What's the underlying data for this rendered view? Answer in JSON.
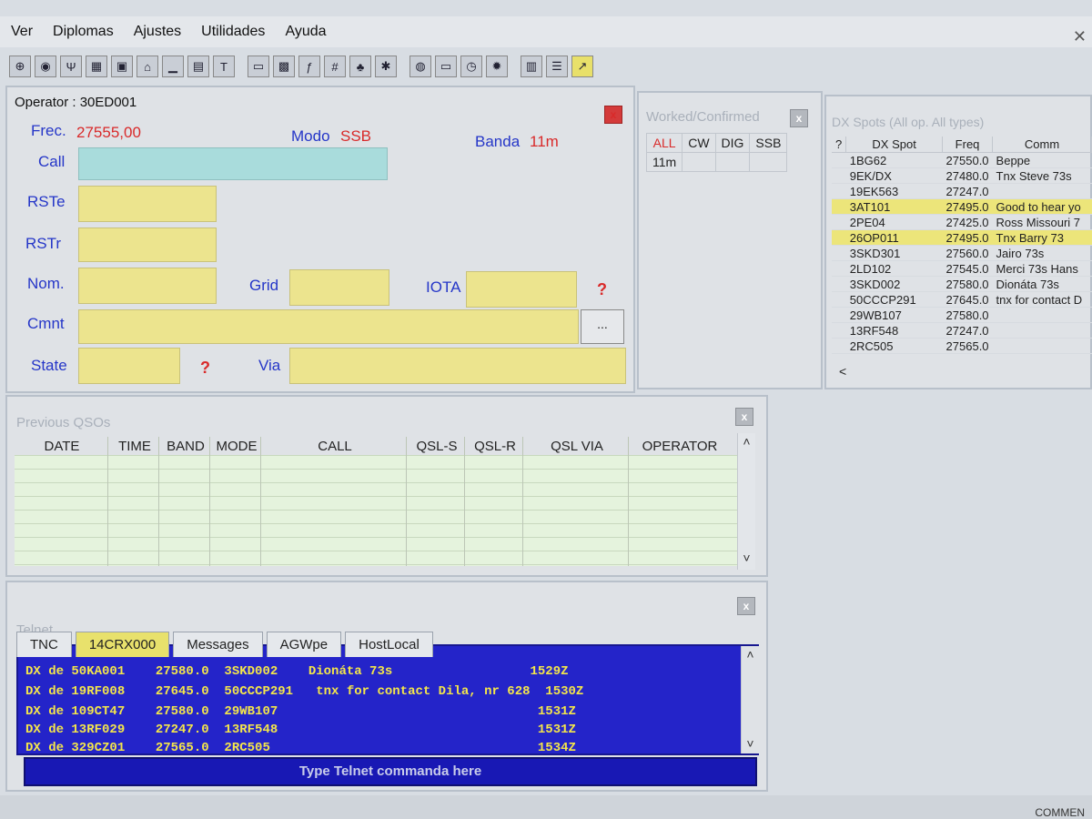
{
  "menu": [
    "Ver",
    "Diplomas",
    "Ajustes",
    "Utilidades",
    "Ayuda"
  ],
  "toolbar_icons": [
    "globe-icon",
    "radio-icon",
    "antenna-icon",
    "table-icon",
    "image-icon",
    "house-icon",
    "chart-icon",
    "notebook-icon",
    "text-icon",
    "window-icon",
    "map-icon",
    "fn-icon",
    "calculator-icon",
    "tree-icon",
    "bug-icon",
    "earth-icon",
    "monitor-icon",
    "clock-icon",
    "gear-icon",
    "calendar-icon",
    "align-icon",
    "arrow-icon"
  ],
  "qso": {
    "operator_label": "Operator : 30ED001",
    "close": "x",
    "frec_label": "Frec.",
    "frec_value": "27555,00",
    "modo_label": "Modo",
    "modo_value": "SSB",
    "banda_label": "Banda",
    "banda_value": "11m",
    "call_label": "Call",
    "rste_label": "RSTe",
    "rstr_label": "RSTr",
    "nom_label": "Nom.",
    "grid_label": "Grid",
    "iota_label": "IOTA",
    "cmnt_label": "Cmnt",
    "state_label": "State",
    "via_label": "Via",
    "help_mark": "?",
    "more_button": "..."
  },
  "worked": {
    "title": "Worked/Confirmed",
    "columns": [
      "ALL",
      "CW",
      "DIG",
      "SSB"
    ],
    "row_band": "11m"
  },
  "spots": {
    "title": "DX Spots (All op. All types)",
    "columns": [
      "?",
      "DX Spot",
      "Freq",
      "Comm"
    ],
    "rows": [
      {
        "call": "1BG62",
        "freq": "27550.0",
        "comment": "Beppe",
        "hl": false
      },
      {
        "call": "9EK/DX",
        "freq": "27480.0",
        "comment": "Tnx  Steve 73s",
        "hl": false
      },
      {
        "call": "19EK563",
        "freq": "27247.0",
        "comment": "",
        "hl": false
      },
      {
        "call": "3AT101",
        "freq": "27495.0",
        "comment": "Good to hear yo",
        "hl": true
      },
      {
        "call": "2PE04",
        "freq": "27425.0",
        "comment": "Ross Missouri 7",
        "hl": false
      },
      {
        "call": "26OP011",
        "freq": "27495.0",
        "comment": "Tnx Barry 73",
        "hl": true
      },
      {
        "call": "3SKD301",
        "freq": "27560.0",
        "comment": "Jairo  73s",
        "hl": false
      },
      {
        "call": "2LD102",
        "freq": "27545.0",
        "comment": "Merci 73s Hans",
        "hl": false
      },
      {
        "call": "3SKD002",
        "freq": "27580.0",
        "comment": "Dionáta 73s",
        "hl": false
      },
      {
        "call": "50CCCP291",
        "freq": "27645.0",
        "comment": "tnx for contact D",
        "hl": false
      },
      {
        "call": "29WB107",
        "freq": "27580.0",
        "comment": "",
        "hl": false
      },
      {
        "call": "13RF548",
        "freq": "27247.0",
        "comment": "",
        "hl": false
      },
      {
        "call": "2RC505",
        "freq": "27565.0",
        "comment": "",
        "hl": false
      }
    ],
    "scroll_left": "<"
  },
  "previous": {
    "title": "Previous QSOs",
    "columns": [
      "DATE",
      "TIME",
      "BAND",
      "MODE",
      "CALL",
      "QSL-S",
      "QSL-R",
      "QSL VIA",
      "OPERATOR"
    ]
  },
  "telnet": {
    "title": "Telnet",
    "tabs": [
      "TNC",
      "14CRX000",
      "Messages",
      "AGWpe",
      "HostLocal"
    ],
    "lines": [
      "DX de 50KA001    27580.0  3SKD002    Dionáta 73s                  1529Z",
      "DX de 19RF008    27645.0  50CCCP291   tnx for contact Dila, nr 628  1530Z",
      "DX de 109CT47    27580.0  29WB107                                  1531Z",
      "DX de 13RF029    27247.0  13RF548                                  1531Z",
      "DX de 329CZ01    27565.0  2RC505                                   1534Z"
    ],
    "command_placeholder": "Type Telnet commanda here"
  },
  "status": {
    "right_text": "COMMEN"
  }
}
